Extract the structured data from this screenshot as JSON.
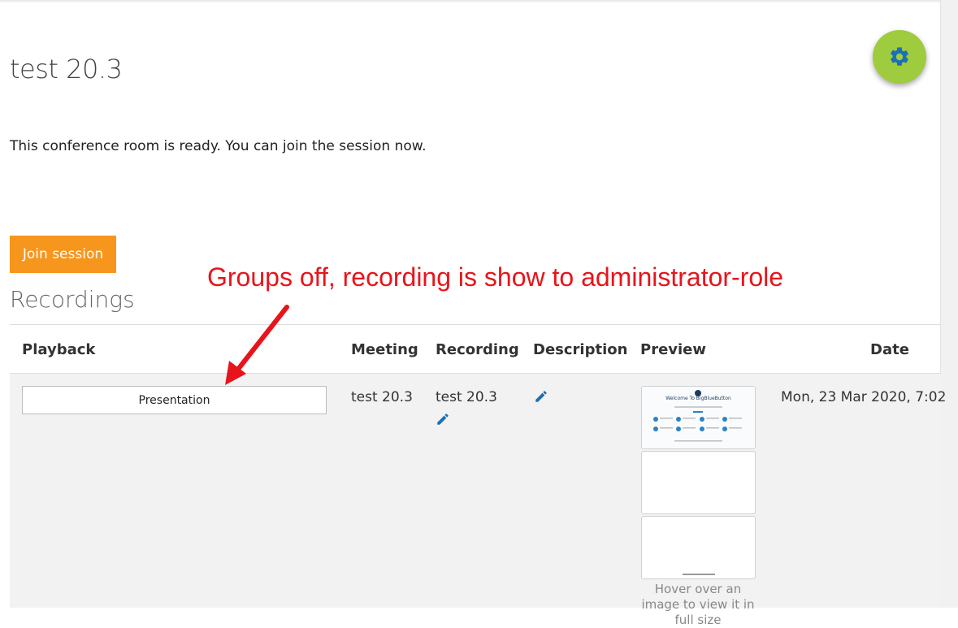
{
  "page": {
    "title": "test 20.3",
    "status_message": "This conference room is ready. You can join the session now."
  },
  "settings": {
    "icon": "gear-icon",
    "accent": "#9fcb3e",
    "icon_color": "#1c6fb5"
  },
  "actions": {
    "join_label": "Join session",
    "join_color": "#f7961c"
  },
  "annotation": {
    "text": "Groups off, recording is show to administrator-role",
    "color": "#e8141b"
  },
  "recordings": {
    "title": "Recordings",
    "columns": [
      "Playback",
      "Meeting",
      "Recording",
      "Description",
      "Preview",
      "Date"
    ],
    "rows": [
      {
        "playback_label": "Presentation",
        "meeting": "test 20.3",
        "recording": "test 20.3",
        "date": "Mon, 23 Mar 2020, 7:02",
        "preview_caption": "Welcome To BigBlueButton",
        "preview_hint": "Hover over an image to view it in full size"
      }
    ]
  }
}
